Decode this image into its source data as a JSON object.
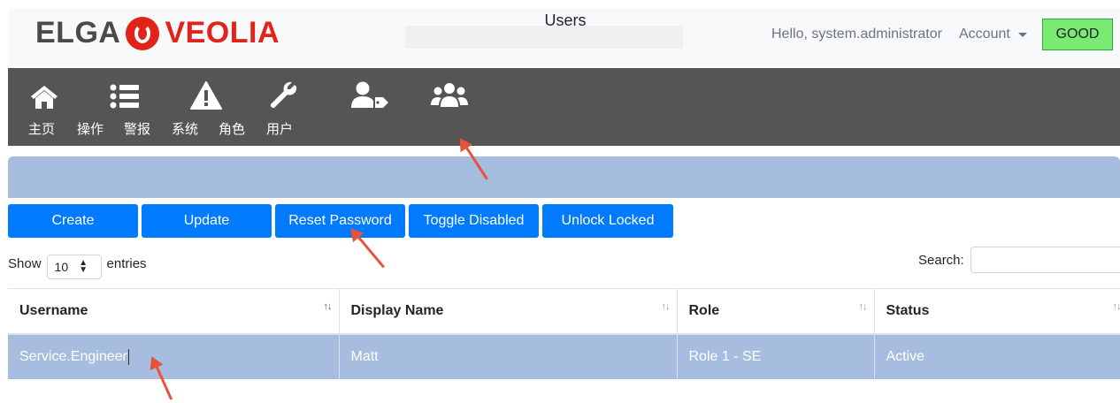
{
  "brand": {
    "logo_left": "ELGA",
    "logo_right": "VEOLIA"
  },
  "topbar": {
    "greeting": "Hello, system.administrator",
    "account_label": "Account",
    "status_label": "GOOD",
    "status_color": "#7aea73"
  },
  "nav": {
    "items": [
      {
        "label": "主页",
        "icon": "home-icon"
      },
      {
        "label": "操作",
        "icon": "list-icon"
      },
      {
        "label": "警报",
        "icon": "warning-icon"
      },
      {
        "label": "系统",
        "icon": "wrench-icon"
      },
      {
        "label": "角色",
        "icon": "user-tag-icon"
      },
      {
        "label": "用户",
        "icon": "users-icon"
      }
    ]
  },
  "panel": {
    "title": "Users"
  },
  "toolbar": {
    "create": "Create",
    "update": "Update",
    "reset_password": "Reset Password",
    "toggle_disabled": "Toggle Disabled",
    "unlock_locked": "Unlock Locked"
  },
  "table_controls": {
    "show_label": "Show",
    "page_size": "10",
    "entries_label": "entries",
    "search_label": "Search:",
    "search_value": ""
  },
  "table": {
    "columns": [
      "Username",
      "Display Name",
      "Role",
      "Status"
    ],
    "rows": [
      {
        "username": "Service.Engineer",
        "display_name": "Matt",
        "role": "Role 1 - SE",
        "status": "Active"
      }
    ]
  },
  "colors": {
    "accent": "#007bff",
    "navbar": "#555555",
    "panel": "#a7bde0",
    "annotation": "#e8523a"
  }
}
